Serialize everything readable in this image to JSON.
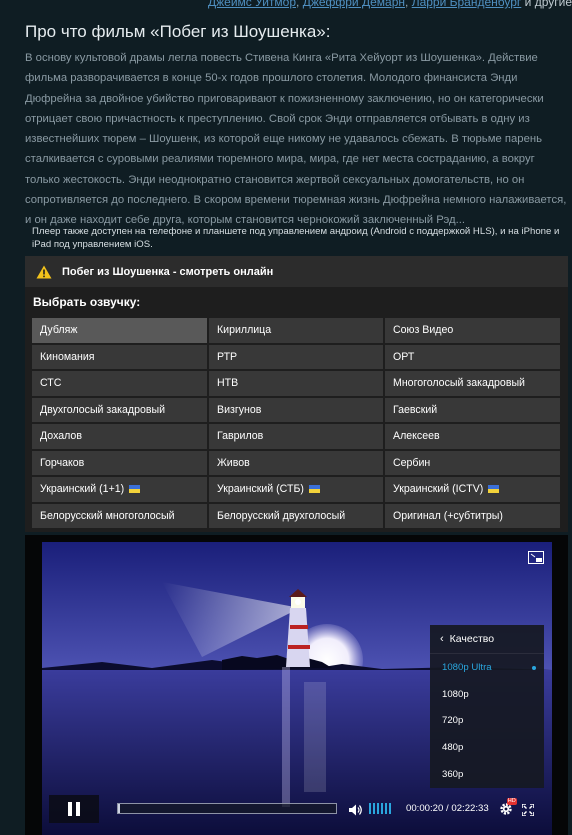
{
  "cast": {
    "names": [
      "Джеймс Уитмор",
      "Джеффри Демарн",
      "Ларри Бранденбург"
    ],
    "separator": ",",
    "and_more": "и другие"
  },
  "about": {
    "title": "Про что фильм «Побег из Шоушенка»:",
    "description": "В основу культовой драмы легла повесть Стивена Кинга «Рита Хейуорт из Шоушенка». Действие фильма разворачивается в конце 50-х годов прошлого столетия. Молодого финансиста Энди Дюфрейна за двойное убийство приговаривают к пожизненному заключению, но он категорически отрицает свою причастность к преступлению. Свой срок Энди отправляется отбывать в одну из известнейших тюрем – Шоушенк, из которой еще никому не удавалось сбежать. В тюрьме парень сталкивается с суровыми реалиями тюремного мира, мира, где нет места состраданию, а вокруг только жестокость. Энди неоднократно становится жертвой сексуальных домогательств, но он сопротивляется до последнего. В скором времени тюремная жизнь Дюфрейна немного налаживается, и он даже находит себе друга, которым становится чернокожий заключенный Рэд..."
  },
  "player_note": "Плеер также доступен на телефоне и планшете под управлением андроид (Android с поддержкой HLS), и на iPhone и iPad под управлением iOS.",
  "player": {
    "header_icon": "warning-icon",
    "title": "Побег из Шоушенка - смотреть онлайн",
    "voice_heading": "Выбрать озвучку:",
    "voices": [
      {
        "label": "Дубляж",
        "active": true,
        "flag": false
      },
      {
        "label": "Кириллица",
        "active": false,
        "flag": false
      },
      {
        "label": "Союз Видео",
        "active": false,
        "flag": false
      },
      {
        "label": "Киномания",
        "active": false,
        "flag": false
      },
      {
        "label": "РТР",
        "active": false,
        "flag": false
      },
      {
        "label": "ОРТ",
        "active": false,
        "flag": false
      },
      {
        "label": "СТС",
        "active": false,
        "flag": false
      },
      {
        "label": "НТВ",
        "active": false,
        "flag": false
      },
      {
        "label": "Многоголосый закадровый",
        "active": false,
        "flag": false
      },
      {
        "label": "Двухголосый закадровый",
        "active": false,
        "flag": false
      },
      {
        "label": "Визгунов",
        "active": false,
        "flag": false
      },
      {
        "label": "Гаевский",
        "active": false,
        "flag": false
      },
      {
        "label": "Дохалов",
        "active": false,
        "flag": false
      },
      {
        "label": "Гаврилов",
        "active": false,
        "flag": false
      },
      {
        "label": "Алексеев",
        "active": false,
        "flag": false
      },
      {
        "label": "Горчаков",
        "active": false,
        "flag": false
      },
      {
        "label": "Живов",
        "active": false,
        "flag": false
      },
      {
        "label": "Сербин",
        "active": false,
        "flag": false
      },
      {
        "label": "Украинский (1+1)",
        "active": false,
        "flag": true
      },
      {
        "label": "Украинский (СТБ)",
        "active": false,
        "flag": true
      },
      {
        "label": "Украинский (ICTV)",
        "active": false,
        "flag": true
      },
      {
        "label": "Белорусский многоголосый",
        "active": false,
        "flag": false
      },
      {
        "label": "Белорусский двухголосый",
        "active": false,
        "flag": false
      },
      {
        "label": "Оригинал (+субтитры)",
        "active": false,
        "flag": false
      }
    ]
  },
  "video": {
    "quality_menu": {
      "title": "Качество",
      "options": [
        "1080p Ultra",
        "1080p",
        "720p",
        "480p",
        "360p"
      ],
      "selected": "1080p Ultra"
    },
    "progress_fraction": 0.009,
    "volume_level_bars": 6,
    "time_current": "00:00:20",
    "time_total": "02:22:33",
    "time_separator": " / ",
    "hd_badge": "HD",
    "colors": {
      "accent": "#2aa6de",
      "badge": "#e2302f"
    }
  }
}
